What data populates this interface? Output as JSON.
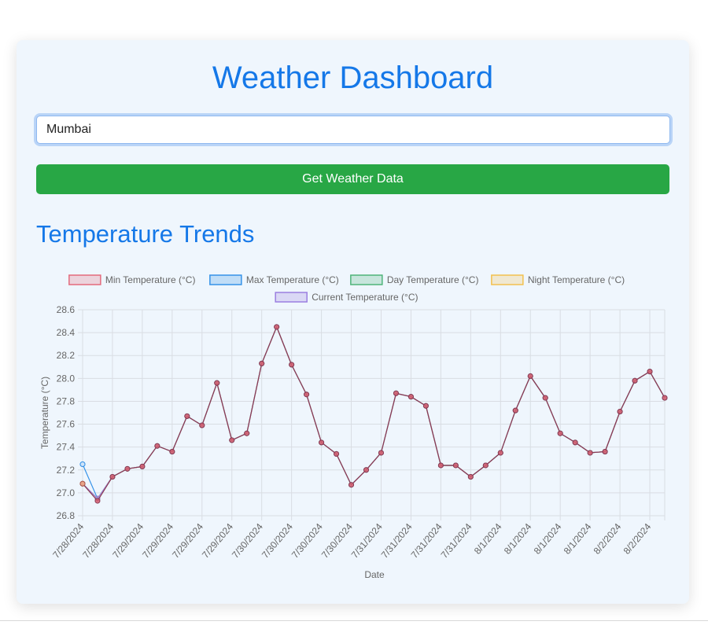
{
  "page": {
    "title": "Weather Dashboard",
    "city_input_value": "Mumbai",
    "get_button_label": "Get Weather Data",
    "section_title": "Temperature Trends"
  },
  "chart_data": {
    "type": "line",
    "xlabel": "Date",
    "ylabel": "Temperature (°C)",
    "ylim": [
      26.8,
      28.6
    ],
    "ytick_step": 0.2,
    "legend_position": "top",
    "grid": true,
    "x": [
      "7/28/2024",
      "7/28/2024",
      "7/28/2024",
      "7/29/2024",
      "7/29/2024",
      "7/29/2024",
      "7/29/2024",
      "7/29/2024",
      "7/29/2024",
      "7/29/2024",
      "7/29/2024",
      "7/30/2024",
      "7/30/2024",
      "7/30/2024",
      "7/30/2024",
      "7/30/2024",
      "7/30/2024",
      "7/30/2024",
      "7/30/2024",
      "7/31/2024",
      "7/31/2024",
      "7/31/2024",
      "7/31/2024",
      "7/31/2024",
      "7/31/2024",
      "7/31/2024",
      "7/31/2024",
      "8/1/2024",
      "8/1/2024",
      "8/1/2024",
      "8/1/2024",
      "8/1/2024",
      "8/1/2024",
      "8/1/2024",
      "8/1/2024",
      "8/2/2024",
      "8/2/2024",
      "8/2/2024",
      "8/2/2024",
      "8/2/2024"
    ],
    "xtick_labels": [
      "7/28/2024",
      "7/28/2024",
      "7/29/2024",
      "7/29/2024",
      "7/29/2024",
      "7/29/2024",
      "7/30/2024",
      "7/30/2024",
      "7/30/2024",
      "7/30/2024",
      "7/31/2024",
      "7/31/2024",
      "7/31/2024",
      "7/31/2024",
      "8/1/2024",
      "8/1/2024",
      "8/1/2024",
      "8/1/2024",
      "8/2/2024",
      "8/2/2024"
    ],
    "series": [
      {
        "name": "Min Temperature (°C)",
        "color": "#e36a7d",
        "fill": "rgba(227,106,125,0.25)",
        "values": [
          27.08,
          26.93,
          27.14,
          27.21,
          27.23,
          27.41,
          27.36,
          27.67,
          27.59,
          27.96,
          27.46,
          27.52,
          28.13,
          28.45,
          28.12,
          27.86,
          27.44,
          27.34,
          27.07,
          27.2,
          27.35,
          27.87,
          27.84,
          27.76,
          27.24,
          27.24,
          27.14,
          27.24,
          27.35,
          27.72,
          28.02,
          27.83,
          27.52,
          27.44,
          27.35,
          27.36,
          27.71,
          27.98,
          28.06,
          27.83
        ]
      },
      {
        "name": "Max Temperature (°C)",
        "color": "#3592e8",
        "fill": "rgba(53,146,232,0.25)",
        "values": [
          27.25,
          26.95,
          27.14,
          27.21,
          27.23,
          27.41,
          27.36,
          27.67,
          27.59,
          27.96,
          27.46,
          27.52,
          28.13,
          28.45,
          28.12,
          27.86,
          27.44,
          27.34,
          27.07,
          27.2,
          27.35,
          27.87,
          27.84,
          27.76,
          27.24,
          27.24,
          27.14,
          27.24,
          27.35,
          27.72,
          28.02,
          27.83,
          27.52,
          27.44,
          27.35,
          27.36,
          27.71,
          27.98,
          28.06,
          27.83
        ]
      },
      {
        "name": "Day Temperature (°C)",
        "color": "#4fb47a",
        "fill": "rgba(79,180,122,0.25)",
        "values": [
          27.08,
          26.95,
          27.14,
          27.21,
          27.23,
          27.41,
          27.36,
          27.67,
          27.59,
          27.96,
          27.46,
          27.52,
          28.13,
          28.45,
          28.12,
          27.86,
          27.44,
          27.34,
          27.07,
          27.2,
          27.35,
          27.87,
          27.84,
          27.76,
          27.24,
          27.24,
          27.14,
          27.24,
          27.35,
          27.72,
          28.02,
          27.83,
          27.52,
          27.44,
          27.35,
          27.36,
          27.71,
          27.98,
          28.06,
          27.83
        ]
      },
      {
        "name": "Night Temperature (°C)",
        "color": "#f2c14e",
        "fill": "rgba(242,193,78,0.25)",
        "values": [
          27.08,
          26.95,
          27.14,
          27.21,
          27.23,
          27.41,
          27.36,
          27.67,
          27.59,
          27.96,
          27.46,
          27.52,
          28.13,
          28.45,
          28.12,
          27.86,
          27.44,
          27.34,
          27.07,
          27.2,
          27.35,
          27.87,
          27.84,
          27.76,
          27.24,
          27.24,
          27.14,
          27.24,
          27.35,
          27.72,
          28.02,
          27.83,
          27.52,
          27.44,
          27.35,
          27.36,
          27.71,
          27.98,
          28.06,
          27.83
        ]
      },
      {
        "name": "Current Temperature (°C)",
        "color": "#9b7fe0",
        "fill": "rgba(155,127,224,0.25)",
        "values": [
          27.08,
          26.95,
          27.14,
          27.21,
          27.23,
          27.41,
          27.36,
          27.67,
          27.59,
          27.96,
          27.46,
          27.52,
          28.13,
          28.45,
          28.12,
          27.86,
          27.44,
          27.34,
          27.07,
          27.2,
          27.35,
          27.87,
          27.84,
          27.76,
          27.24,
          27.24,
          27.14,
          27.24,
          27.35,
          27.72,
          28.02,
          27.83,
          27.52,
          27.44,
          27.35,
          27.36,
          27.71,
          27.98,
          28.06,
          27.83
        ]
      }
    ],
    "overlay_color": "#8a3a52"
  }
}
